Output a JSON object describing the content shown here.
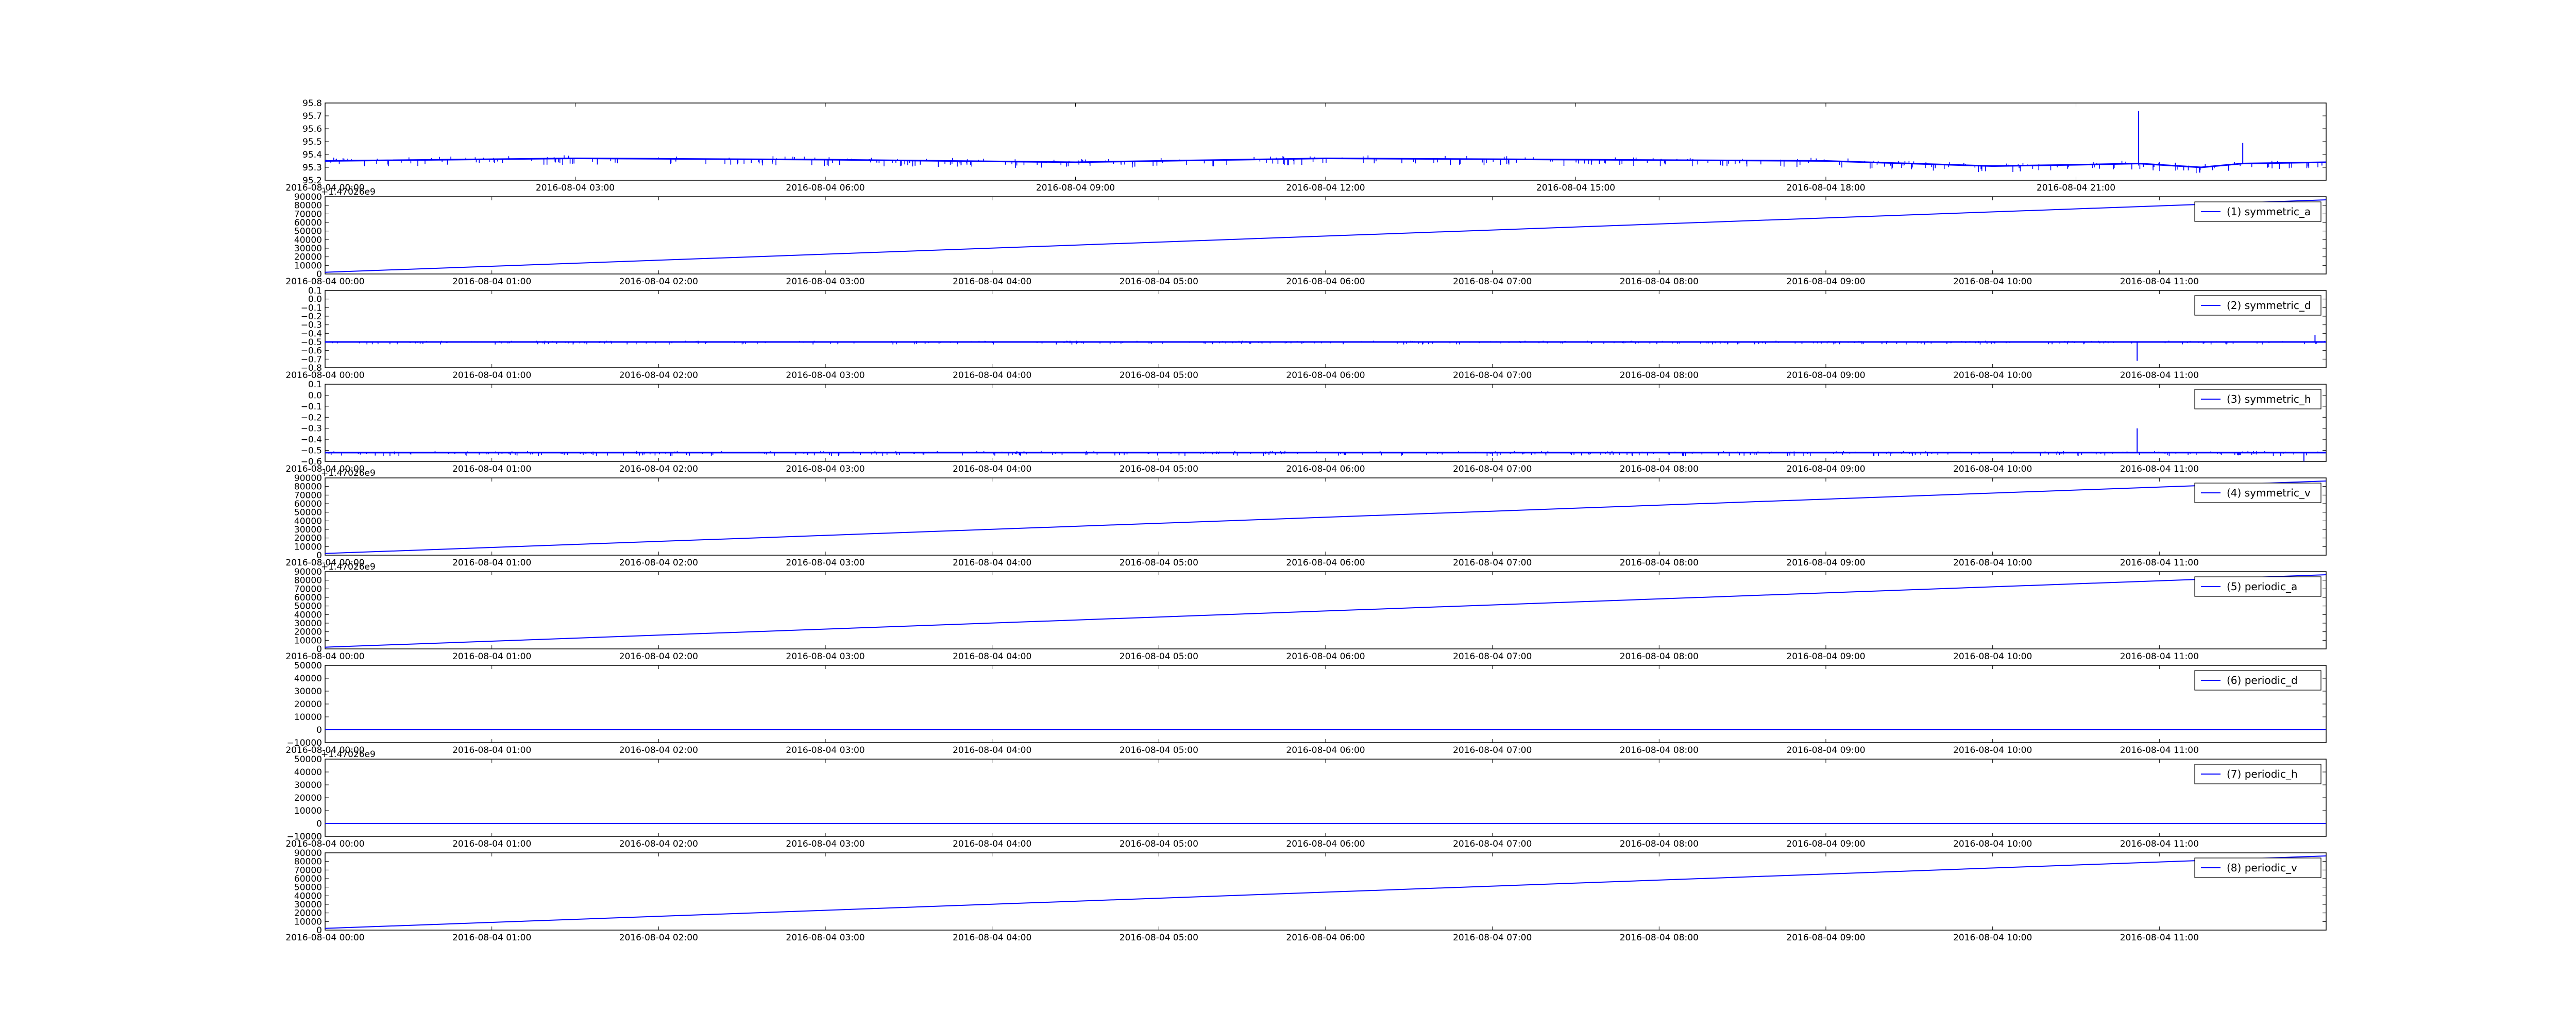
{
  "chart_data": [
    {
      "type": "line",
      "x_unit": "time",
      "xticks": [
        "2016-08-04 00:00",
        "2016-08-04 03:00",
        "2016-08-04 06:00",
        "2016-08-04 09:00",
        "2016-08-04 12:00",
        "2016-08-04 15:00",
        "2016-08-04 18:00",
        "2016-08-04 21:00"
      ],
      "yticks": [
        "95.2",
        "95.3",
        "95.4",
        "95.5",
        "95.6",
        "95.7",
        "95.8"
      ],
      "ylim": [
        95.2,
        95.8
      ],
      "xlim": [
        "2016-08-04 00:00",
        "2016-08-05 00:00"
      ],
      "series": [
        {
          "name": "",
          "color": "#0000ff",
          "baseline": [
            [
              "2016-08-04 00:00",
              95.35
            ],
            [
              "2016-08-04 03:00",
              95.37
            ],
            [
              "2016-08-04 06:00",
              95.36
            ],
            [
              "2016-08-04 09:00",
              95.34
            ],
            [
              "2016-08-04 12:00",
              95.37
            ],
            [
              "2016-08-04 15:00",
              95.36
            ],
            [
              "2016-08-04 18:00",
              95.35
            ],
            [
              "2016-08-04 20:00",
              95.31
            ],
            [
              "2016-08-04 21:00",
              95.32
            ],
            [
              "2016-08-04 21:45",
              95.33
            ],
            [
              "2016-08-04 22:30",
              95.3
            ],
            [
              "2016-08-04 23:00",
              95.33
            ],
            [
              "2016-08-05 00:00",
              95.34
            ]
          ],
          "spikes": [
            [
              "2016-08-04 21:45",
              95.74
            ],
            [
              "2016-08-04 23:00",
              95.49
            ]
          ],
          "dip_depth": 0.05
        }
      ]
    },
    {
      "type": "line",
      "offset_label": "+1.47026e9",
      "xticks": [
        "2016-08-04 00:00",
        "2016-08-04 01:00",
        "2016-08-04 02:00",
        "2016-08-04 03:00",
        "2016-08-04 04:00",
        "2016-08-04 05:00",
        "2016-08-04 06:00",
        "2016-08-04 07:00",
        "2016-08-04 08:00",
        "2016-08-04 09:00",
        "2016-08-04 10:00",
        "2016-08-04 11:00"
      ],
      "yticks": [
        "0",
        "10000",
        "20000",
        "30000",
        "40000",
        "50000",
        "60000",
        "70000",
        "80000",
        "90000"
      ],
      "ylim": [
        0,
        90000
      ],
      "xlim": [
        "2016-08-04 00:00",
        "2016-08-04 12:00"
      ],
      "legend_loc": "upper right",
      "series": [
        {
          "name": "(1) symmetric_a",
          "color": "#0000ff",
          "points": [
            [
              "2016-08-04 00:00",
              2000
            ],
            [
              "2016-08-04 12:00",
              86400
            ]
          ]
        }
      ]
    },
    {
      "type": "line",
      "xticks": [
        "2016-08-04 00:00",
        "2016-08-04 01:00",
        "2016-08-04 02:00",
        "2016-08-04 03:00",
        "2016-08-04 04:00",
        "2016-08-04 05:00",
        "2016-08-04 06:00",
        "2016-08-04 07:00",
        "2016-08-04 08:00",
        "2016-08-04 09:00",
        "2016-08-04 10:00",
        "2016-08-04 11:00"
      ],
      "yticks": [
        "−0.8",
        "−0.7",
        "−0.6",
        "−0.5",
        "−0.4",
        "−0.3",
        "−0.2",
        "−0.1",
        "0.0",
        "0.1"
      ],
      "ylim": [
        -0.8,
        0.1
      ],
      "xlim": [
        "2016-08-04 00:00",
        "2016-08-04 12:00"
      ],
      "legend_loc": "upper right",
      "series": [
        {
          "name": "(2) symmetric_d",
          "color": "#0000ff",
          "baseline": [
            [
              "2016-08-04 00:00",
              -0.5
            ],
            [
              "2016-08-04 12:00",
              -0.5
            ]
          ],
          "spikes": [
            [
              "2016-08-04 10:52",
              -0.72
            ],
            [
              "2016-08-04 11:56",
              -0.42
            ]
          ],
          "dip_depth": 0.03
        }
      ]
    },
    {
      "type": "line",
      "xticks": [
        "2016-08-04 00:00",
        "2016-08-04 01:00",
        "2016-08-04 02:00",
        "2016-08-04 03:00",
        "2016-08-04 04:00",
        "2016-08-04 05:00",
        "2016-08-04 06:00",
        "2016-08-04 07:00",
        "2016-08-04 08:00",
        "2016-08-04 09:00",
        "2016-08-04 10:00",
        "2016-08-04 11:00"
      ],
      "yticks": [
        "−0.6",
        "−0.5",
        "−0.4",
        "−0.3",
        "−0.2",
        "−0.1",
        "0.0",
        "0.1"
      ],
      "ylim": [
        -0.6,
        0.1
      ],
      "xlim": [
        "2016-08-04 00:00",
        "2016-08-04 12:00"
      ],
      "legend_loc": "upper right",
      "series": [
        {
          "name": "(3) symmetric_h",
          "color": "#0000ff",
          "baseline": [
            [
              "2016-08-04 00:00",
              -0.52
            ],
            [
              "2016-08-04 12:00",
              -0.52
            ]
          ],
          "spikes": [
            [
              "2016-08-04 10:52",
              -0.3
            ],
            [
              "2016-08-04 11:52",
              -0.6
            ]
          ],
          "dip_depth": 0.03
        }
      ]
    },
    {
      "type": "line",
      "offset_label": "+1.47026e9",
      "xticks": [
        "2016-08-04 00:00",
        "2016-08-04 01:00",
        "2016-08-04 02:00",
        "2016-08-04 03:00",
        "2016-08-04 04:00",
        "2016-08-04 05:00",
        "2016-08-04 06:00",
        "2016-08-04 07:00",
        "2016-08-04 08:00",
        "2016-08-04 09:00",
        "2016-08-04 10:00",
        "2016-08-04 11:00"
      ],
      "yticks": [
        "0",
        "10000",
        "20000",
        "30000",
        "40000",
        "50000",
        "60000",
        "70000",
        "80000",
        "90000"
      ],
      "ylim": [
        0,
        90000
      ],
      "xlim": [
        "2016-08-04 00:00",
        "2016-08-04 12:00"
      ],
      "legend_loc": "upper right",
      "series": [
        {
          "name": "(4) symmetric_v",
          "color": "#0000ff",
          "points": [
            [
              "2016-08-04 00:00",
              2000
            ],
            [
              "2016-08-04 12:00",
              86400
            ]
          ]
        }
      ]
    },
    {
      "type": "line",
      "offset_label": "+1.47026e9",
      "xticks": [
        "2016-08-04 00:00",
        "2016-08-04 01:00",
        "2016-08-04 02:00",
        "2016-08-04 03:00",
        "2016-08-04 04:00",
        "2016-08-04 05:00",
        "2016-08-04 06:00",
        "2016-08-04 07:00",
        "2016-08-04 08:00",
        "2016-08-04 09:00",
        "2016-08-04 10:00",
        "2016-08-04 11:00"
      ],
      "yticks": [
        "0",
        "10000",
        "20000",
        "30000",
        "40000",
        "50000",
        "60000",
        "70000",
        "80000",
        "90000"
      ],
      "ylim": [
        0,
        90000
      ],
      "xlim": [
        "2016-08-04 00:00",
        "2016-08-04 12:00"
      ],
      "legend_loc": "upper right",
      "series": [
        {
          "name": "(5) periodic_a",
          "color": "#0000ff",
          "points": [
            [
              "2016-08-04 00:00",
              2000
            ],
            [
              "2016-08-04 12:00",
              86400
            ]
          ]
        }
      ]
    },
    {
      "type": "line",
      "xticks": [
        "2016-08-04 00:00",
        "2016-08-04 01:00",
        "2016-08-04 02:00",
        "2016-08-04 03:00",
        "2016-08-04 04:00",
        "2016-08-04 05:00",
        "2016-08-04 06:00",
        "2016-08-04 07:00",
        "2016-08-04 08:00",
        "2016-08-04 09:00",
        "2016-08-04 10:00",
        "2016-08-04 11:00"
      ],
      "yticks": [
        "−10000",
        "0",
        "10000",
        "20000",
        "30000",
        "40000",
        "50000"
      ],
      "ylim": [
        -10000,
        50000
      ],
      "xlim": [
        "2016-08-04 00:00",
        "2016-08-04 12:00"
      ],
      "legend_loc": "upper right",
      "series": [
        {
          "name": "(6) periodic_d",
          "color": "#0000ff",
          "points": [
            [
              "2016-08-04 00:00",
              0
            ],
            [
              "2016-08-04 12:00",
              0
            ]
          ]
        }
      ]
    },
    {
      "type": "line",
      "offset_label": "+1.47026e9",
      "xticks": [
        "2016-08-04 00:00",
        "2016-08-04 01:00",
        "2016-08-04 02:00",
        "2016-08-04 03:00",
        "2016-08-04 04:00",
        "2016-08-04 05:00",
        "2016-08-04 06:00",
        "2016-08-04 07:00",
        "2016-08-04 08:00",
        "2016-08-04 09:00",
        "2016-08-04 10:00",
        "2016-08-04 11:00"
      ],
      "yticks": [
        "−10000",
        "0",
        "10000",
        "20000",
        "30000",
        "40000",
        "50000"
      ],
      "ylim": [
        -10000,
        50000
      ],
      "xlim": [
        "2016-08-04 00:00",
        "2016-08-04 12:00"
      ],
      "legend_loc": "upper right",
      "series": [
        {
          "name": "(7) periodic_h",
          "color": "#0000ff",
          "points": [
            [
              "2016-08-04 00:00",
              0
            ],
            [
              "2016-08-04 12:00",
              0
            ]
          ]
        }
      ]
    },
    {
      "type": "line",
      "xticks": [
        "2016-08-04 00:00",
        "2016-08-04 01:00",
        "2016-08-04 02:00",
        "2016-08-04 03:00",
        "2016-08-04 04:00",
        "2016-08-04 05:00",
        "2016-08-04 06:00",
        "2016-08-04 07:00",
        "2016-08-04 08:00",
        "2016-08-04 09:00",
        "2016-08-04 10:00",
        "2016-08-04 11:00"
      ],
      "yticks": [
        "0",
        "10000",
        "20000",
        "30000",
        "40000",
        "50000",
        "60000",
        "70000",
        "80000",
        "90000"
      ],
      "ylim": [
        0,
        90000
      ],
      "xlim": [
        "2016-08-04 00:00",
        "2016-08-04 12:00"
      ],
      "legend_loc": "upper right",
      "series": [
        {
          "name": "(8) periodic_v",
          "color": "#0000ff",
          "points": [
            [
              "2016-08-04 00:00",
              2000
            ],
            [
              "2016-08-04 12:00",
              86400
            ]
          ]
        }
      ]
    }
  ]
}
